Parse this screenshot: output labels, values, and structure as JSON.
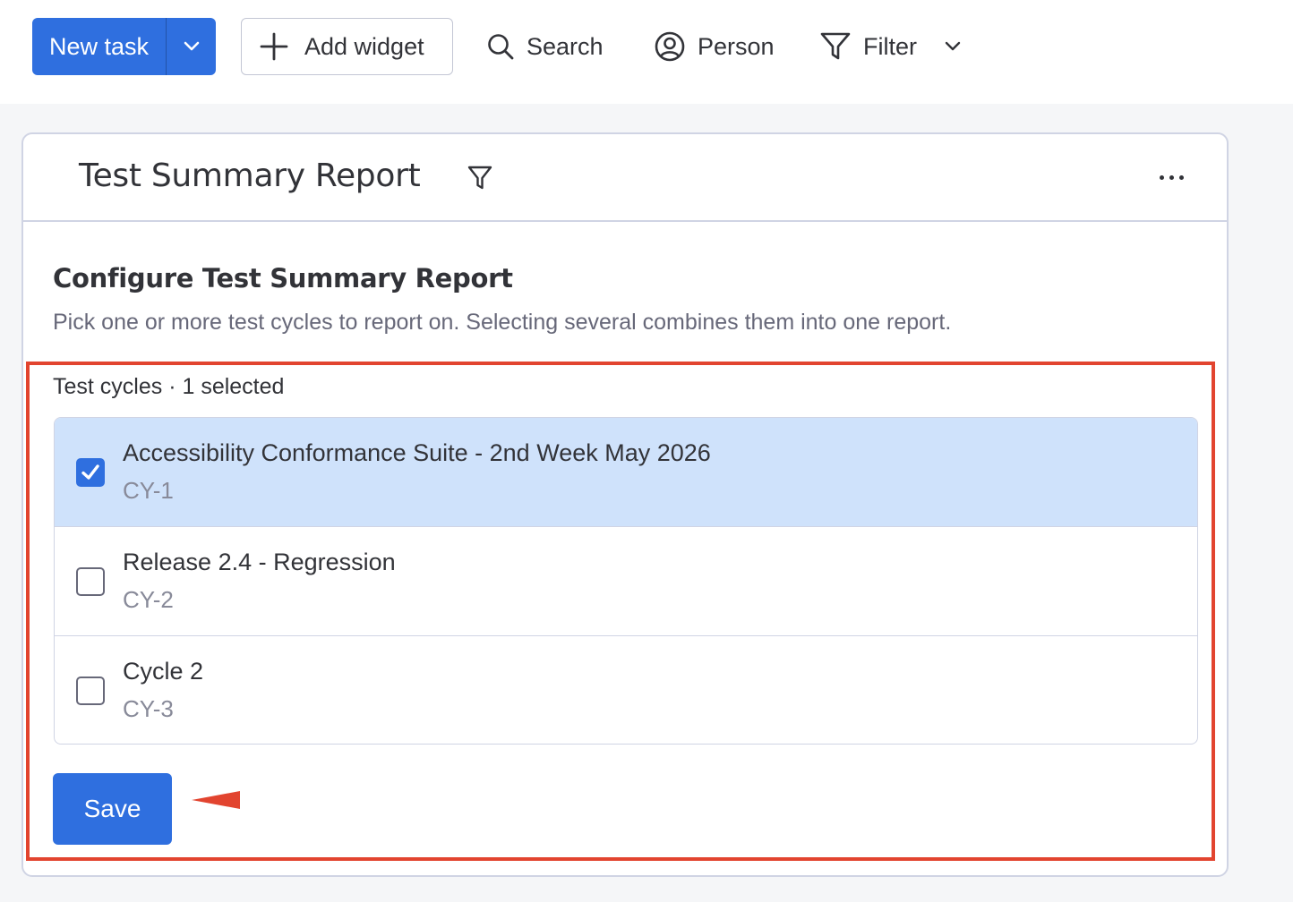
{
  "toolbar": {
    "new_task_label": "New task",
    "add_widget_label": "Add widget",
    "search_label": "Search",
    "person_label": "Person",
    "filter_label": "Filter"
  },
  "card": {
    "title": "Test Summary Report",
    "config_title": "Configure Test Summary Report",
    "config_description": "Pick one or more test cycles to report on. Selecting several combines them into one report.",
    "cycles_label": "Test cycles · 1 selected",
    "cycles": [
      {
        "title": "Accessibility Conformance Suite - 2nd Week May 2026",
        "code": "CY-1",
        "checked": true
      },
      {
        "title": "Release 2.4 - Regression",
        "code": "CY-2",
        "checked": false
      },
      {
        "title": "Cycle 2",
        "code": "CY-3",
        "checked": false
      }
    ],
    "save_label": "Save"
  },
  "colors": {
    "primary": "#2f6fdf",
    "selected_row": "#cfe2fb",
    "highlight": "#e2442f",
    "canvas": "#f5f6f8"
  }
}
